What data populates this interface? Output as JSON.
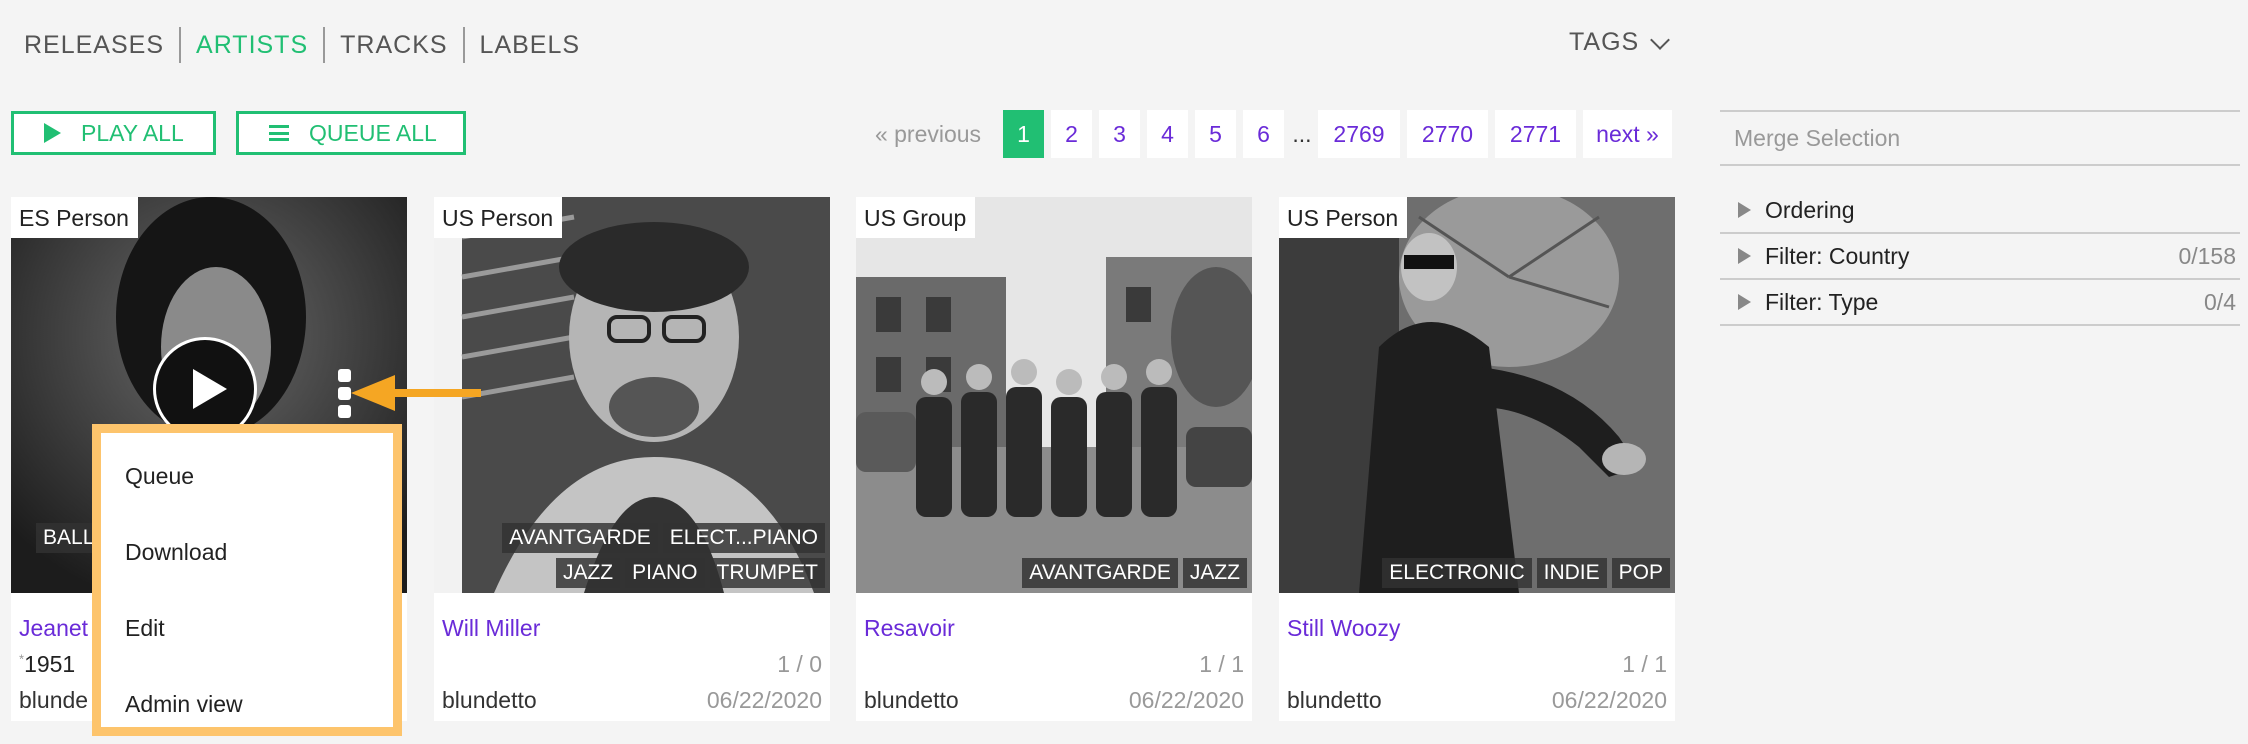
{
  "nav": {
    "items": [
      {
        "label": "RELEASES"
      },
      {
        "label": "ARTISTS"
      },
      {
        "label": "TRACKS"
      },
      {
        "label": "LABELS"
      }
    ],
    "active": "ARTISTS"
  },
  "tags_label": "TAGS",
  "buttons": {
    "play_all": "PLAY ALL",
    "queue_all": "QUEUE ALL"
  },
  "pagination": {
    "previous": "« previous",
    "pages": [
      "1",
      "2",
      "3",
      "4",
      "5",
      "6"
    ],
    "ellipsis": "...",
    "last_pages": [
      "2769",
      "2770",
      "2771"
    ],
    "next": "next »",
    "current": "1"
  },
  "cards": [
    {
      "badge": "ES Person",
      "name": "Jeanet",
      "year": "1951",
      "user": "blunde",
      "tags": [
        "BALL"
      ]
    },
    {
      "badge": "US Person",
      "name": "Will Miller",
      "ratio": "1 / 0",
      "user": "blundetto",
      "date": "06/22/2020",
      "tags_row1": [
        "AVANTGARDE",
        "ELECT...PIANO"
      ],
      "tags_row2": [
        "JAZZ",
        "PIANO",
        "TRUMPET"
      ]
    },
    {
      "badge": "US Group",
      "name": "Resavoir",
      "ratio": "1 / 1",
      "user": "blundetto",
      "date": "06/22/2020",
      "tags_row1": [
        "AVANTGARDE",
        "JAZZ"
      ]
    },
    {
      "badge": "US Person",
      "name": "Still Woozy",
      "ratio": "1 / 1",
      "user": "blundetto",
      "date": "06/22/2020",
      "tags_row1": [
        "ELECTRONIC",
        "INDIE",
        "POP"
      ]
    }
  ],
  "context_menu": {
    "items": [
      "Queue",
      "Download",
      "Edit",
      "Admin view"
    ]
  },
  "sidebar": {
    "merge": "Merge Selection",
    "ordering": "Ordering",
    "filters": [
      {
        "label": "Filter: Country",
        "count": "0/158"
      },
      {
        "label": "Filter: Type",
        "count": "0/4"
      }
    ]
  },
  "colors": {
    "accent": "#21bf73",
    "link": "#6a2bd8",
    "highlight": "#fdc46c",
    "arrow": "#f5a623"
  }
}
